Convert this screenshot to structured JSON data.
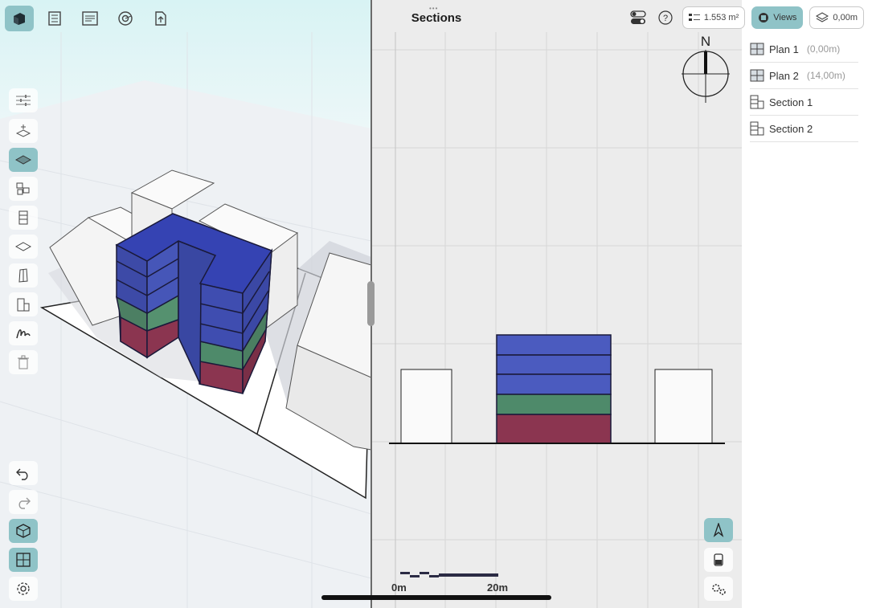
{
  "header": {
    "title": "Sections"
  },
  "top_right": {
    "area_value": "1.553 m²",
    "views_label": "Views",
    "level_value": "0,00m"
  },
  "views": [
    {
      "label": "Plan 1",
      "sub": "(0,00m)",
      "icon": "plan-icon"
    },
    {
      "label": "Plan 2",
      "sub": "(14,00m)",
      "icon": "plan-icon"
    },
    {
      "label": "Section 1",
      "sub": "",
      "icon": "section-icon"
    },
    {
      "label": "Section 2",
      "sub": "",
      "icon": "section-icon"
    }
  ],
  "compass": {
    "north": "N"
  },
  "scale_bar": {
    "start": "0m",
    "end": "20m"
  },
  "colors": {
    "accent": "#8fc3c7",
    "floor_blue": "#4b5bbf",
    "floor_green": "#4e8a6a",
    "floor_red": "#8b3550"
  }
}
